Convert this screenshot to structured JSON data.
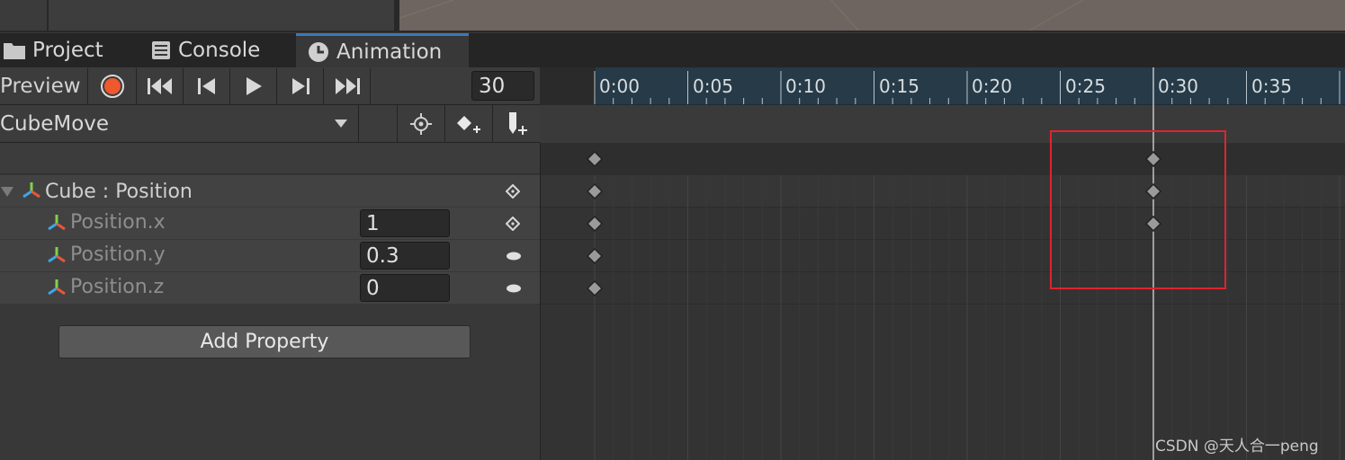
{
  "tabs": [
    {
      "label": "Project",
      "icon": "folder-icon"
    },
    {
      "label": "Console",
      "icon": "console-icon"
    },
    {
      "label": "Animation",
      "icon": "clock-icon",
      "active": true
    }
  ],
  "toolbar": {
    "preview_label": "Preview",
    "frame_value": "30",
    "icons": [
      "record-icon",
      "first-key-icon",
      "prev-key-icon",
      "play-icon",
      "next-key-icon",
      "last-key-icon"
    ]
  },
  "clip": {
    "name": "CubeMove",
    "icons": [
      "chevron-down-icon",
      "filter-by-selection-icon",
      "add-keyframe-icon",
      "add-event-icon"
    ]
  },
  "properties": {
    "group": {
      "label": "Cube : Position",
      "icon": "transform-axes-icon"
    },
    "items": [
      {
        "label": "Position.x",
        "value": "1",
        "key_state": "diamond"
      },
      {
        "label": "Position.y",
        "value": "0.3",
        "key_state": "oval"
      },
      {
        "label": "Position.z",
        "value": "0",
        "key_state": "oval"
      }
    ],
    "add_button": "Add Property"
  },
  "timeline": {
    "ticks": [
      "0:00",
      "0:05",
      "0:10",
      "0:15",
      "0:20",
      "0:25",
      "0:30",
      "0:35"
    ],
    "playhead_frame": 30,
    "keyframes": {
      "summary": [
        0,
        30
      ],
      "Cube : Position": [
        0,
        30
      ],
      "Position.x": [
        0,
        30
      ],
      "Position.y": [
        0
      ],
      "Position.z": [
        0
      ]
    },
    "accent_color": "#263a48",
    "highlight_color": "#e0232e"
  },
  "watermark": "CSDN @天人合一peng"
}
